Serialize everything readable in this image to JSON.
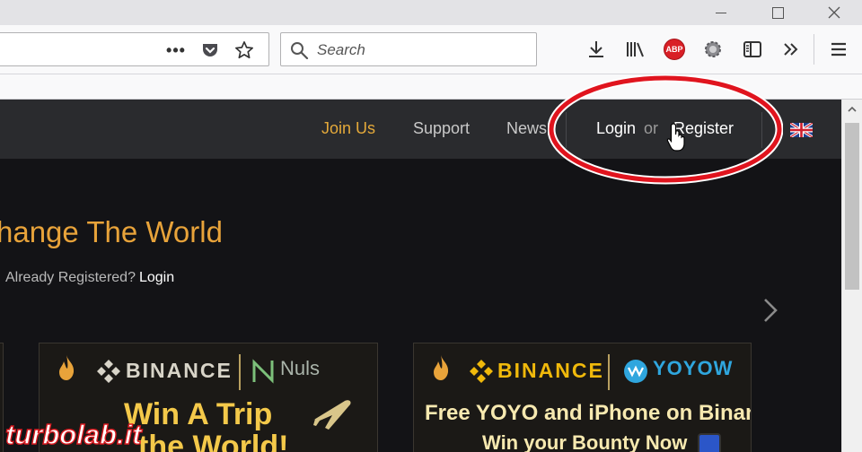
{
  "browser": {
    "search": {
      "placeholder": "Search"
    },
    "toolbar": {
      "download": "download-icon",
      "library": "library-icon",
      "adblock_badge": "ABP",
      "extension": "gear-icon",
      "sidebar": "sidebar-icon",
      "overflow": "overflow-icon",
      "menu": "hamburger-menu-icon"
    }
  },
  "site": {
    "nav": {
      "join": "Join Us",
      "support": "Support",
      "news": "News",
      "login": "Login",
      "or": "or",
      "register": "Register"
    },
    "hero": {
      "title": "hange The World",
      "subtitle": "Already Registered?",
      "subtitle_link": "Login"
    },
    "banners": [
      {
        "brand": "BINANCE",
        "partner": "Nuls",
        "line1": "Win A Trip",
        "line2": "the World!"
      },
      {
        "brand": "BINANCE",
        "partner": "YOYOW",
        "line1": "Free YOYO and iPhone on Binance",
        "line2": "Win your Bounty Now"
      }
    ]
  },
  "watermark": "turbolab.it",
  "colors": {
    "accent_gold": "#e8a33a",
    "binance_yellow": "#f0b90b",
    "highlight_red": "#e0141e",
    "nav_bg": "#2a2b2e",
    "page_bg": "#131316"
  }
}
